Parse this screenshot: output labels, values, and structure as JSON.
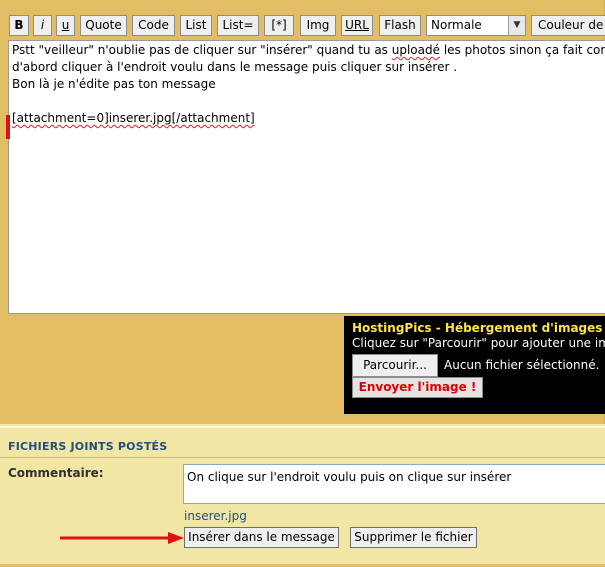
{
  "toolbar": {
    "bold": "B",
    "italic": "i",
    "underline": "u",
    "quote": "Quote",
    "code": "Code",
    "list": "List",
    "list_eq": "List=",
    "list_item": "[*]",
    "img": "Img",
    "url": "URL",
    "flash": "Flash",
    "font_size": "Normale",
    "color": "Couleur de"
  },
  "message": {
    "line1": "Pstt \"veilleur\" n'oublie pas de cliquer sur \"insérer\" quand tu as ",
    "line1_link": "uploadé",
    "line1_end": " les photos sinon ça fait comme",
    "line2": "d'abord cliquer à l'endroit voulu dans le message puis cliquer sur insérer .",
    "line3": "Bon là je n'édite pas ton message",
    "attachment_open": "[attachment=0]",
    "attachment_file": "inserer.jpg",
    "attachment_close": "[/attachment]"
  },
  "hosting": {
    "title": "HostingPics - Hébergement d'images gratuit",
    "hint": "Cliquez sur \"Parcourir\" pour ajouter une image",
    "browse": "Parcourir...",
    "file_status": "Aucun fichier sélectionné.",
    "send": "Envoyer l'image !"
  },
  "attachments": {
    "heading": "FICHIERS JOINTS POSTÉS",
    "comment_label": "Commentaire:",
    "comment_value": "On clique sur l'endroit voulu puis on clique sur insérer",
    "file_name": "inserer.jpg",
    "insert_button": "Insérer dans le message",
    "delete_button": "Supprimer le fichier"
  },
  "colors": {
    "panel": "#e3bd64",
    "attachments_bg": "#f2e6a4",
    "arrow": "#e01010",
    "hosting_title": "#ffe24a",
    "send_text": "#e00000"
  }
}
